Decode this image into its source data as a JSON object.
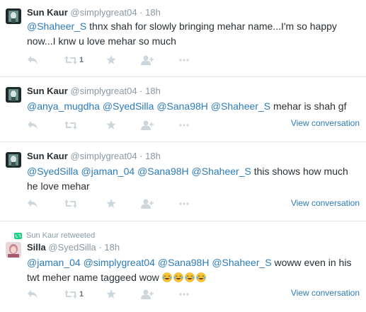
{
  "tweets": [
    {
      "name": "Sun Kaur",
      "handle": "@simplygreat04",
      "dot": "·",
      "time": "18h",
      "text_parts": [
        "@Shaheer_S",
        " thnx shah for slowly bringing mehar name...I'm so happy now...I knw u love mehar so much"
      ],
      "retweet_count": "1",
      "view_conversation": ""
    },
    {
      "name": "Sun Kaur",
      "handle": "@simplygreat04",
      "dot": "·",
      "time": "18h",
      "text_parts": [
        "@anya_mugdha",
        " ",
        "@SyedSilla",
        " ",
        "@Sana98H",
        " ",
        "@Shaheer_S",
        " mehar is shah gf"
      ],
      "retweet_count": "",
      "view_conversation": "View conversation"
    },
    {
      "name": "Sun Kaur",
      "handle": "@simplygreat04",
      "dot": "·",
      "time": "18h",
      "text_parts": [
        "@SyedSilla",
        " ",
        "@jaman_04",
        " ",
        "@Sana98H",
        " ",
        "@Shaheer_S",
        " this shows how much he love mehar"
      ],
      "retweet_count": "",
      "view_conversation": "View conversation"
    },
    {
      "retweeted_by": "Sun Kaur retweeted",
      "name": "Silla",
      "handle": "@SyedSilla",
      "dot": "·",
      "time": "18h",
      "text_parts": [
        "@jaman_04",
        " ",
        "@simplygreat04",
        " ",
        "@Sana98H",
        " ",
        "@Shaheer_S",
        " woww even in his twt meher name taggeed wow "
      ],
      "emoji": [
        "face-with-tears-of-joy",
        "face-with-tears-of-joy",
        "face-with-tears-of-joy",
        "face-with-tears-of-joy"
      ],
      "retweet_count": "1",
      "view_conversation": "View conversation"
    }
  ],
  "colors": {
    "mention": "#2b7bb9",
    "action_icon": "#ccd6dd",
    "meta": "#8899a6",
    "retweet_green": "#19cf86"
  },
  "icons": [
    "reply-icon",
    "retweet-icon",
    "favorite-icon",
    "follow-icon",
    "more-icon"
  ]
}
